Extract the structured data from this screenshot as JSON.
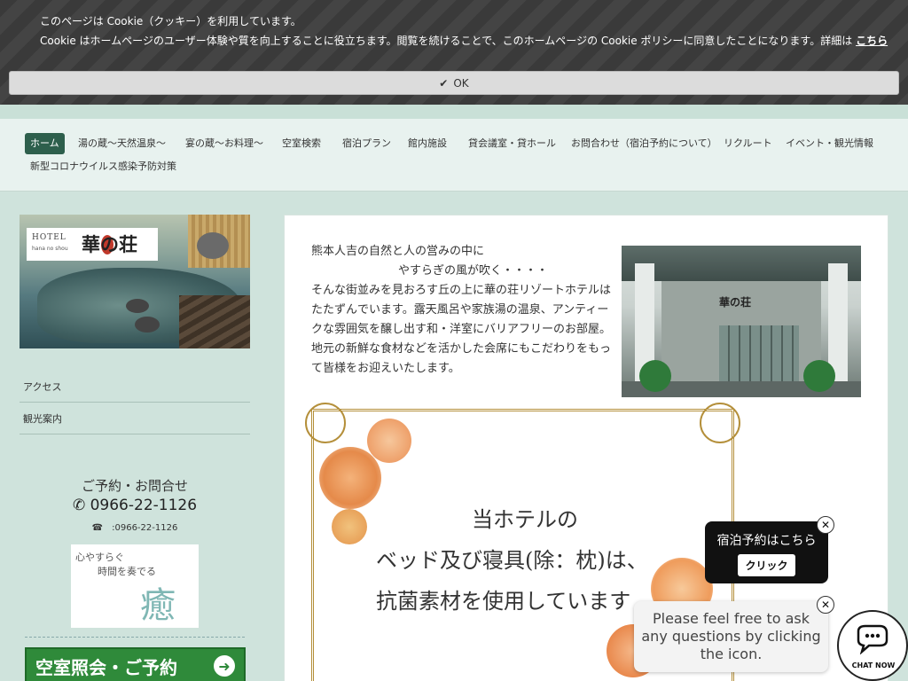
{
  "cookie": {
    "line1": "このページは Cookie（クッキー）を利用しています。",
    "line2": "Cookie はホームページのユーザー体験や質を向上することに役立ちます。閲覧を続けることで、このホームページの Cookie ポリシーに同意したことになります。詳細は",
    "link": "こちら",
    "ok_label": "OK",
    "ok_icon": "check-icon"
  },
  "nav": {
    "items": [
      {
        "label": "ホーム",
        "active": true
      },
      {
        "label": "湯の蔵〜天然温泉〜"
      },
      {
        "label": "宴の蔵〜お料理〜"
      },
      {
        "label": "空室検索"
      },
      {
        "label": "宿泊プラン"
      },
      {
        "label": "館内施設"
      },
      {
        "label": "貸会議室・貸ホール"
      },
      {
        "label": "お問合わせ（宿泊予約について）"
      },
      {
        "label": "リクルート"
      },
      {
        "label": "イベント・観光情報"
      },
      {
        "label": "新型コロナウイルス感染予防対策"
      }
    ]
  },
  "sidebar": {
    "logo": {
      "hotel": "HOTEL",
      "romaji": "hana no shou",
      "name": "華の荘"
    },
    "links": [
      "アクセス",
      "観光案内"
    ],
    "contact_title": "ご予約・お問合せ",
    "phone": "0966-22-1126",
    "phone_sub": "☎　:0966-22-1126",
    "banner": {
      "line1": "心やすらぐ",
      "line2": "時間を奏でる",
      "kanji": "癒"
    },
    "reserve_label": "空室照会・ご予約"
  },
  "main": {
    "intro_line1": "熊本人吉の自然と人の営みの中に",
    "intro_line2": "やすらぎの風が吹く・・・・",
    "intro_body": "そんな街並みを見おろす丘の上に華の荘リゾートホテルはたたずんでいます。露天風呂や家族湯の温泉、アンティークな雰囲気を醸し出す和・洋室にバリアフリーのお部屋。地元の新鮮な食材などを活かした会席にもこだわりをもって皆様をお迎えいたします。",
    "photo_sign": "華の荘",
    "notice_lines": [
      "当ホテルの",
      "ベッド及び寝具(除：枕)は、",
      "抗菌素材を使用しています"
    ]
  },
  "widgets": {
    "booking_title": "宿泊予約はこちら",
    "booking_button": "クリック",
    "chat_message": "Please feel free to ask any questions by clicking the icon.",
    "chat_label": "CHAT NOW"
  },
  "colors": {
    "nav_active": "#2d5f4c",
    "background": "#cfe3dc",
    "reserve_green": "#2f8a3a",
    "frame_gold": "#b48f3a"
  }
}
